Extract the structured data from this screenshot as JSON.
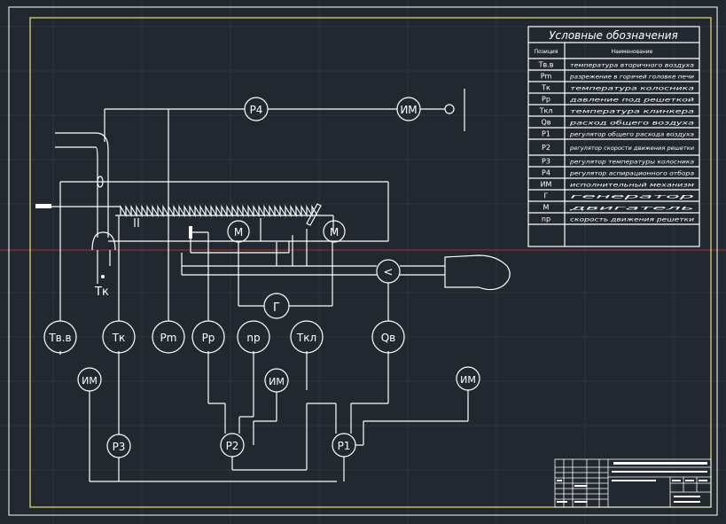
{
  "legend": {
    "title": "Условные обозначения",
    "col_position": "Позиция",
    "col_name": "Наименование",
    "rows": [
      {
        "pos": "Tв.в",
        "name": "температура вторичного воздуха"
      },
      {
        "pos": "Pm",
        "name": "разрежение в горячей головке печи"
      },
      {
        "pos": "Tк",
        "name": "температура колосника"
      },
      {
        "pos": "Pр",
        "name": "давление под решеткой"
      },
      {
        "pos": "Tкл",
        "name": "температура клинкера"
      },
      {
        "pos": "Qв",
        "name": "расход общего воздуха"
      },
      {
        "pos": "P1",
        "name": "регулятор общего расхода воздуха"
      },
      {
        "pos": "P2",
        "name": "регулятор скорости движения решетки"
      },
      {
        "pos": "P3",
        "name": "регулятор температуры колосника"
      },
      {
        "pos": "P4",
        "name": "регулятор аспирационного отбора"
      },
      {
        "pos": "ИМ",
        "name": "исполнительный механизм"
      },
      {
        "pos": "Г",
        "name": "генератор"
      },
      {
        "pos": "М",
        "name": "двигатель"
      },
      {
        "pos": "nр",
        "name": "скорость движения решетки"
      }
    ]
  },
  "diagram": {
    "p4": "P4",
    "im_top": "ИМ",
    "motor1": "М",
    "motor2": "М",
    "generator": "Г",
    "compare": "<",
    "tk_label": "Tк",
    "sensors": [
      "Tв.в",
      "Tк",
      "Pm",
      "Pр",
      "nр",
      "Tкл",
      "Qв"
    ],
    "im_left": "ИМ",
    "im_mid": "ИМ",
    "im_right": "ИМ",
    "p3": "P3",
    "p2": "P2",
    "p1": "P1"
  },
  "colors": {
    "background": "#212830",
    "frame": "#e8e070",
    "lines": "#ffffff",
    "axis_red": "#b03030"
  }
}
